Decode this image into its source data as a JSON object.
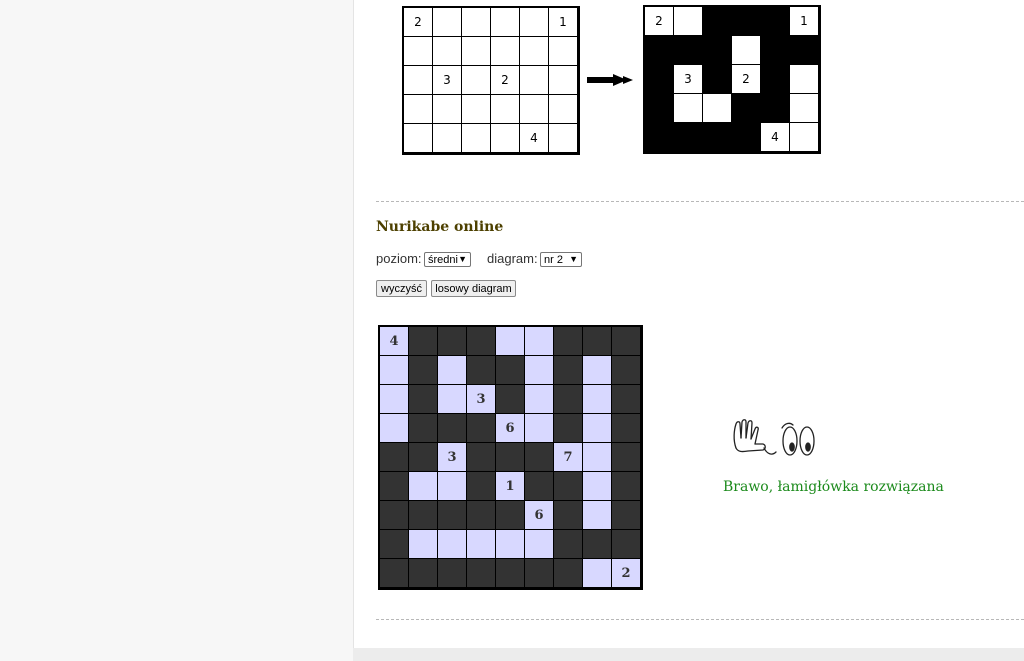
{
  "example": {
    "unsolved": {
      "rows": [
        [
          "2",
          "",
          "",
          "",
          "",
          "1"
        ],
        [
          "",
          "",
          "",
          "",
          "",
          ""
        ],
        [
          "",
          "3",
          "",
          "2",
          "",
          ""
        ],
        [
          "",
          "",
          "",
          "",
          "",
          ""
        ],
        [
          "",
          "",
          "",
          "",
          "4",
          ""
        ]
      ]
    },
    "solved": {
      "rows": [
        [
          "2",
          "",
          "#",
          "#",
          "#",
          "1"
        ],
        [
          "#",
          "#",
          "#",
          "",
          "#",
          "#"
        ],
        [
          "#",
          "3",
          "#",
          "2",
          "#",
          ""
        ],
        [
          "#",
          "",
          "",
          "#",
          "#",
          ""
        ],
        [
          "#",
          "#",
          "#",
          "#",
          "4",
          ""
        ]
      ]
    }
  },
  "game": {
    "title": "Nurikabe online",
    "level_label": "poziom:",
    "level_value": "średni",
    "diagram_label": "diagram:",
    "diagram_value": "nr 2",
    "clear_label": "wyczyść",
    "random_label": "losowy diagram",
    "board": [
      [
        "4",
        "#",
        "#",
        "#",
        ".",
        ".",
        "#",
        "#",
        "#"
      ],
      [
        ".",
        "#",
        ".",
        "#",
        "#",
        ".",
        "#",
        ".",
        "#"
      ],
      [
        ".",
        "#",
        ".",
        "3",
        "#",
        ".",
        "#",
        ".",
        "#"
      ],
      [
        ".",
        "#",
        "#",
        "#",
        "6",
        ".",
        "#",
        ".",
        "#"
      ],
      [
        "#",
        "#",
        "3",
        "#",
        "#",
        "#",
        "7",
        ".",
        "#"
      ],
      [
        "#",
        ".",
        ".",
        "#",
        "1",
        "#",
        "#",
        ".",
        "#"
      ],
      [
        "#",
        "#",
        "#",
        "#",
        "#",
        "6",
        "#",
        ".",
        "#"
      ],
      [
        "#",
        ".",
        ".",
        ".",
        ".",
        ".",
        "#",
        "#",
        "#"
      ],
      [
        "#",
        "#",
        "#",
        "#",
        "#",
        "#",
        "#",
        ".",
        "2"
      ]
    ],
    "success_message": "Brawo, łamigłówka rozwiązana"
  },
  "colors": {
    "dark_cell": "#333333",
    "light_cell": "#d8d8ff",
    "title": "#4d4000",
    "success": "#1b8a1b"
  }
}
